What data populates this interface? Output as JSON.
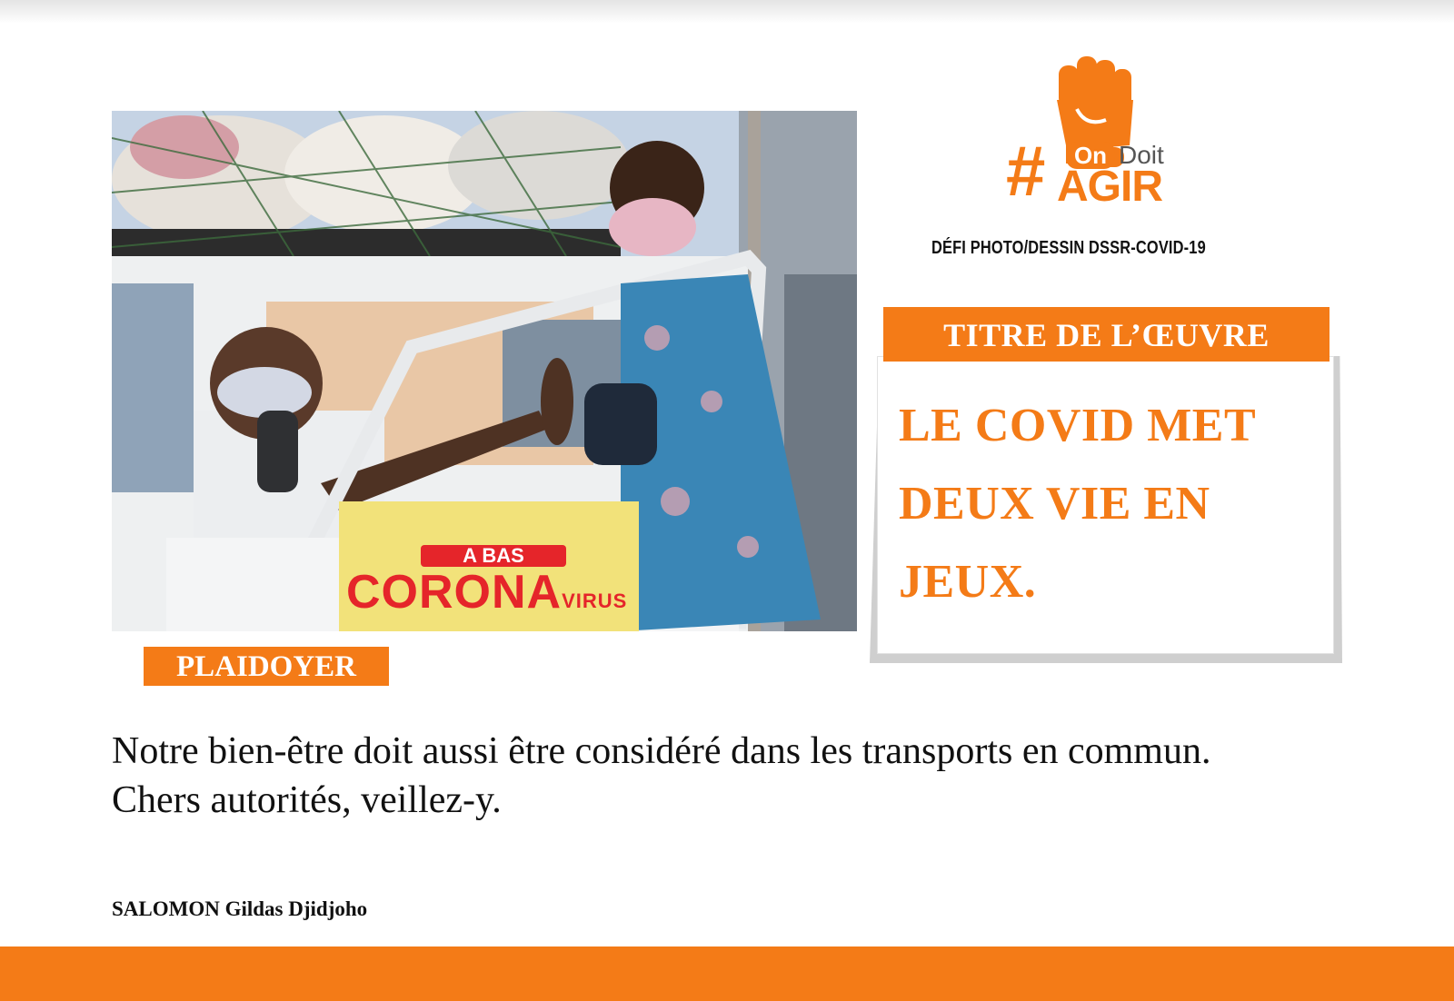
{
  "logo": {
    "hash": "#",
    "on": "On",
    "doit": "Doit",
    "agir": "AGIR"
  },
  "challenge": "DÉFI  PHOTO/DESSIN DSSR-COVID-19",
  "title_card": {
    "header": "TITRE DE L’ŒUVRE",
    "title": "LE COVID MET DEUX VIE EN JEUX."
  },
  "category": "PLAIDOYER",
  "plea": "Notre bien-être doit aussi être considéré dans les transports en commun. Chers autorités, veillez-y.",
  "author": "SALOMON Gildas Djidjoho",
  "photo_sign": {
    "line1": "A BAS",
    "line2": "CORONA",
    "line3": "VIRUS"
  },
  "colors": {
    "accent": "#f47b17",
    "sign_red": "#e5252a",
    "sign_yellow": "#f2e27a"
  }
}
